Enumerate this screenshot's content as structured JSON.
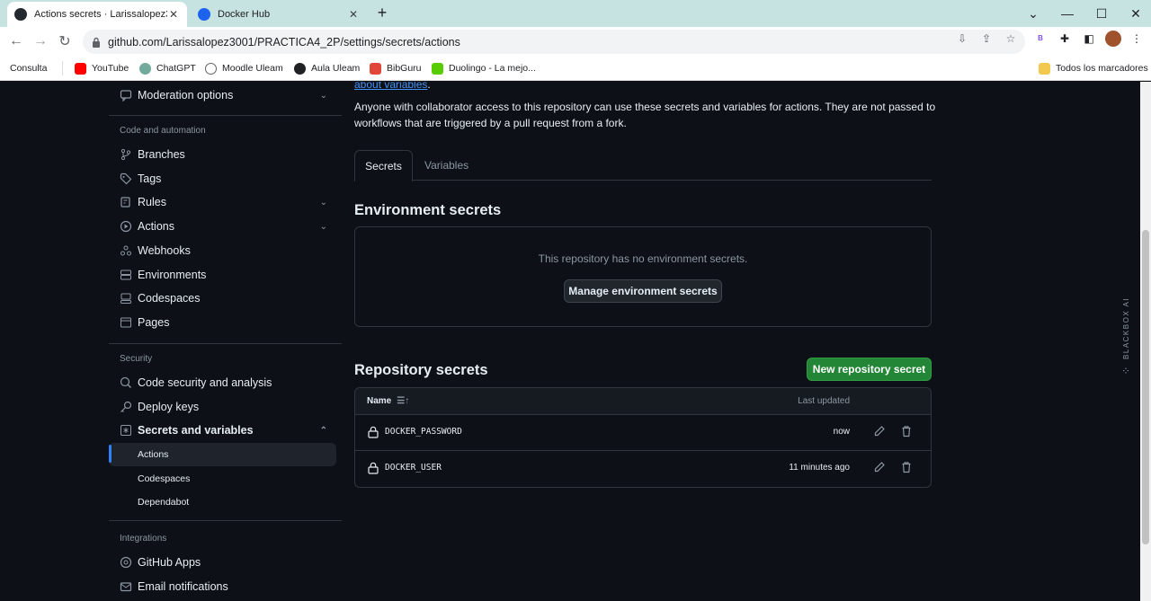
{
  "browser": {
    "tabs": [
      {
        "title": "Actions secrets · Larissalopez3001",
        "active": true
      },
      {
        "title": "Docker Hub",
        "active": false
      }
    ],
    "url": "github.com/Larissalopez3001/PRACTICA4_2P/settings/secrets/actions",
    "profile_badge": "B",
    "bookmarks": [
      {
        "label": "Consulta",
        "color": "#d0021b"
      },
      {
        "label": "YouTube",
        "color": "#ff0000"
      },
      {
        "label": "ChatGPT",
        "color": "#74aa9c"
      },
      {
        "label": "Moodle Uleam",
        "color": "#5f6368"
      },
      {
        "label": "Aula Uleam",
        "color": "#202124"
      },
      {
        "label": "BibGuru",
        "color": "#e0463a"
      },
      {
        "label": "Duolingo - La mejo...",
        "color": "#58cc02"
      }
    ],
    "all_bookmarks": "Todos los marcadores"
  },
  "sidebar": {
    "moderation": "Moderation options",
    "code_heading": "Code and automation",
    "code_items": [
      "Branches",
      "Tags",
      "Rules",
      "Actions",
      "Webhooks",
      "Environments",
      "Codespaces",
      "Pages"
    ],
    "security_heading": "Security",
    "security_items": [
      "Code security and analysis",
      "Deploy keys",
      "Secrets and variables"
    ],
    "secrets_sub": [
      "Actions",
      "Codespaces",
      "Dependabot"
    ],
    "integrations_heading": "Integrations",
    "integrations_items": [
      "GitHub Apps",
      "Email notifications"
    ]
  },
  "main": {
    "top_link": "about variables",
    "top_link_suffix": ".",
    "description_line1": "Anyone with collaborator access to this repository can use these secrets and variables for actions. They are not passed to",
    "description_line2": "workflows that are triggered by a pull request from a fork.",
    "tabs": [
      "Secrets",
      "Variables"
    ],
    "env_heading": "Environment secrets",
    "env_empty": "This repository has no environment secrets.",
    "env_button": "Manage environment secrets",
    "repo_heading": "Repository secrets",
    "new_button": "New repository secret",
    "table": {
      "col_name": "Name",
      "col_updated": "Last updated",
      "rows": [
        {
          "name": "DOCKER_PASSWORD",
          "updated": "now"
        },
        {
          "name": "DOCKER_USER",
          "updated": "11 minutes ago"
        }
      ]
    }
  },
  "extension": {
    "label": "BLACKBOX AI"
  },
  "colors": {
    "accent": "#2f81f7",
    "green": "#238636",
    "tabbar": "#c7e3e1"
  }
}
